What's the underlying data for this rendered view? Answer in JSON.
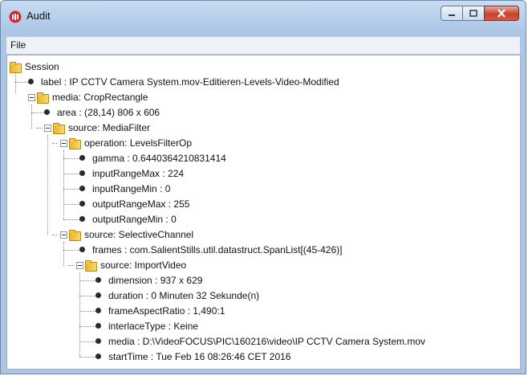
{
  "window": {
    "title": "Audit"
  },
  "menu": {
    "file": "File"
  },
  "tree": {
    "root": "Session",
    "label": "label : IP CCTV Camera System.mov-Editieren-Levels-Video-Modified",
    "media": "media: CropRectangle",
    "area": "area : (28,14) 806 x 606",
    "source1": "source: MediaFilter",
    "operation": "operation: LevelsFilterOp",
    "gamma": "gamma : 0.6440364210831414",
    "inputRangeMax": "inputRangeMax : 224",
    "inputRangeMin": "inputRangeMin : 0",
    "outputRangeMax": "outputRangeMax : 255",
    "outputRangeMin": "outputRangeMin : 0",
    "source2": "source: SelectiveChannel",
    "frames": "frames : com.SalientStills.util.datastruct.SpanList[(45-426)]",
    "source3": "source: ImportVideo",
    "dimension": "dimension : 937 x 629",
    "duration": "duration : 0 Minuten 32 Sekunde(n)",
    "frameAspectRatio": "frameAspectRatio : 1,490:1",
    "interlaceType": "interlaceType : Keine",
    "mediaPath": "media : D:\\VideoFOCUS\\PIC\\160216\\video\\IP CCTV Camera System.mov",
    "startTime": "startTime : Tue Feb 16 08:26:46 CET 2016"
  }
}
